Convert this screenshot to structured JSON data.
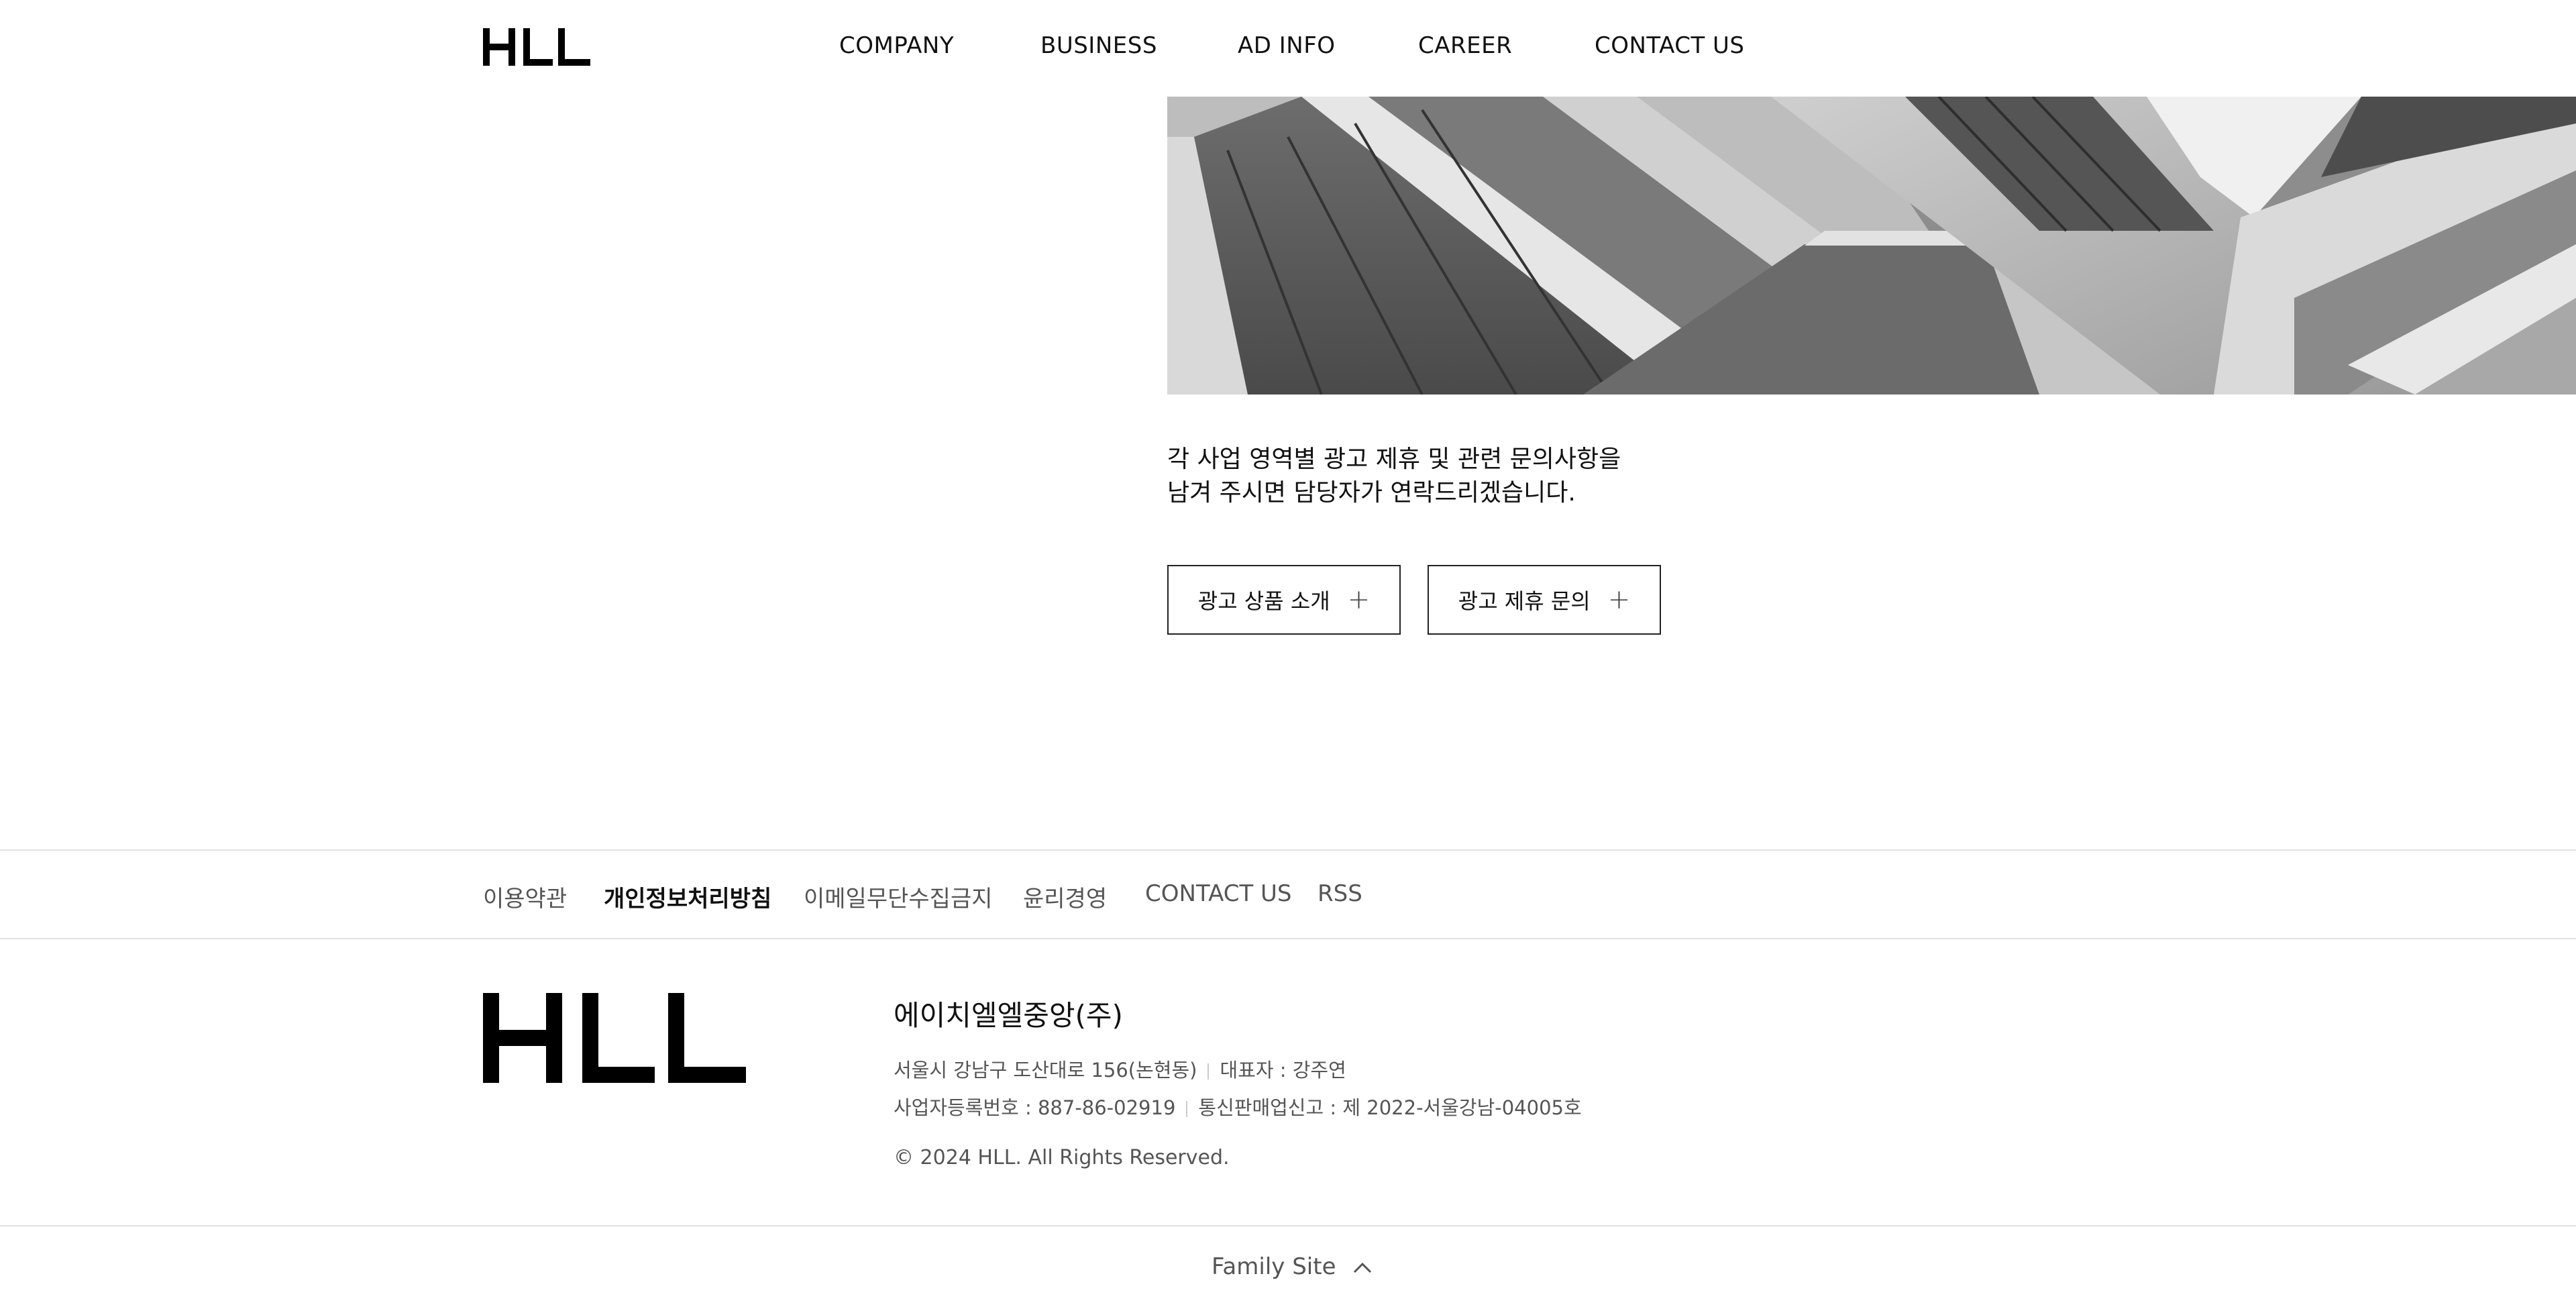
{
  "header": {
    "logo": "HLL",
    "nav": [
      "COMPANY",
      "BUSINESS",
      "AD INFO",
      "CAREER",
      "CONTACT US"
    ]
  },
  "main": {
    "intro_line1": "각 사업 영역별 광고 제휴 및 관련 문의사항을",
    "intro_line2": "남겨 주시면 담당자가 연락드리겠습니다.",
    "buttons": [
      "광고 상품 소개",
      "광고 제휴 문의"
    ],
    "button_icon": "plus-icon"
  },
  "footer": {
    "links": [
      "이용약관",
      "개인정보처리방침",
      "이메일무단수집금지",
      "윤리경영",
      "CONTACT US",
      "RSS"
    ],
    "logo": "HLL",
    "company": "에이치엘엘중앙(주)",
    "address": "서울시 강남구 도산대로 156(논현동)",
    "ceo": "대표자 : 강주연",
    "business_no": "사업자등록번호 : 887-86-02919",
    "ecommerce_no": "통신판매업신고 : 제 2022-서울강남-04005호",
    "copyright": "© 2024 HLL. All Rights Reserved.",
    "family_site": "Family Site",
    "family_icon": "chevron-up-icon"
  },
  "colors": {
    "text": "#111111",
    "muted": "#555555",
    "border": "#e2e2e2"
  }
}
